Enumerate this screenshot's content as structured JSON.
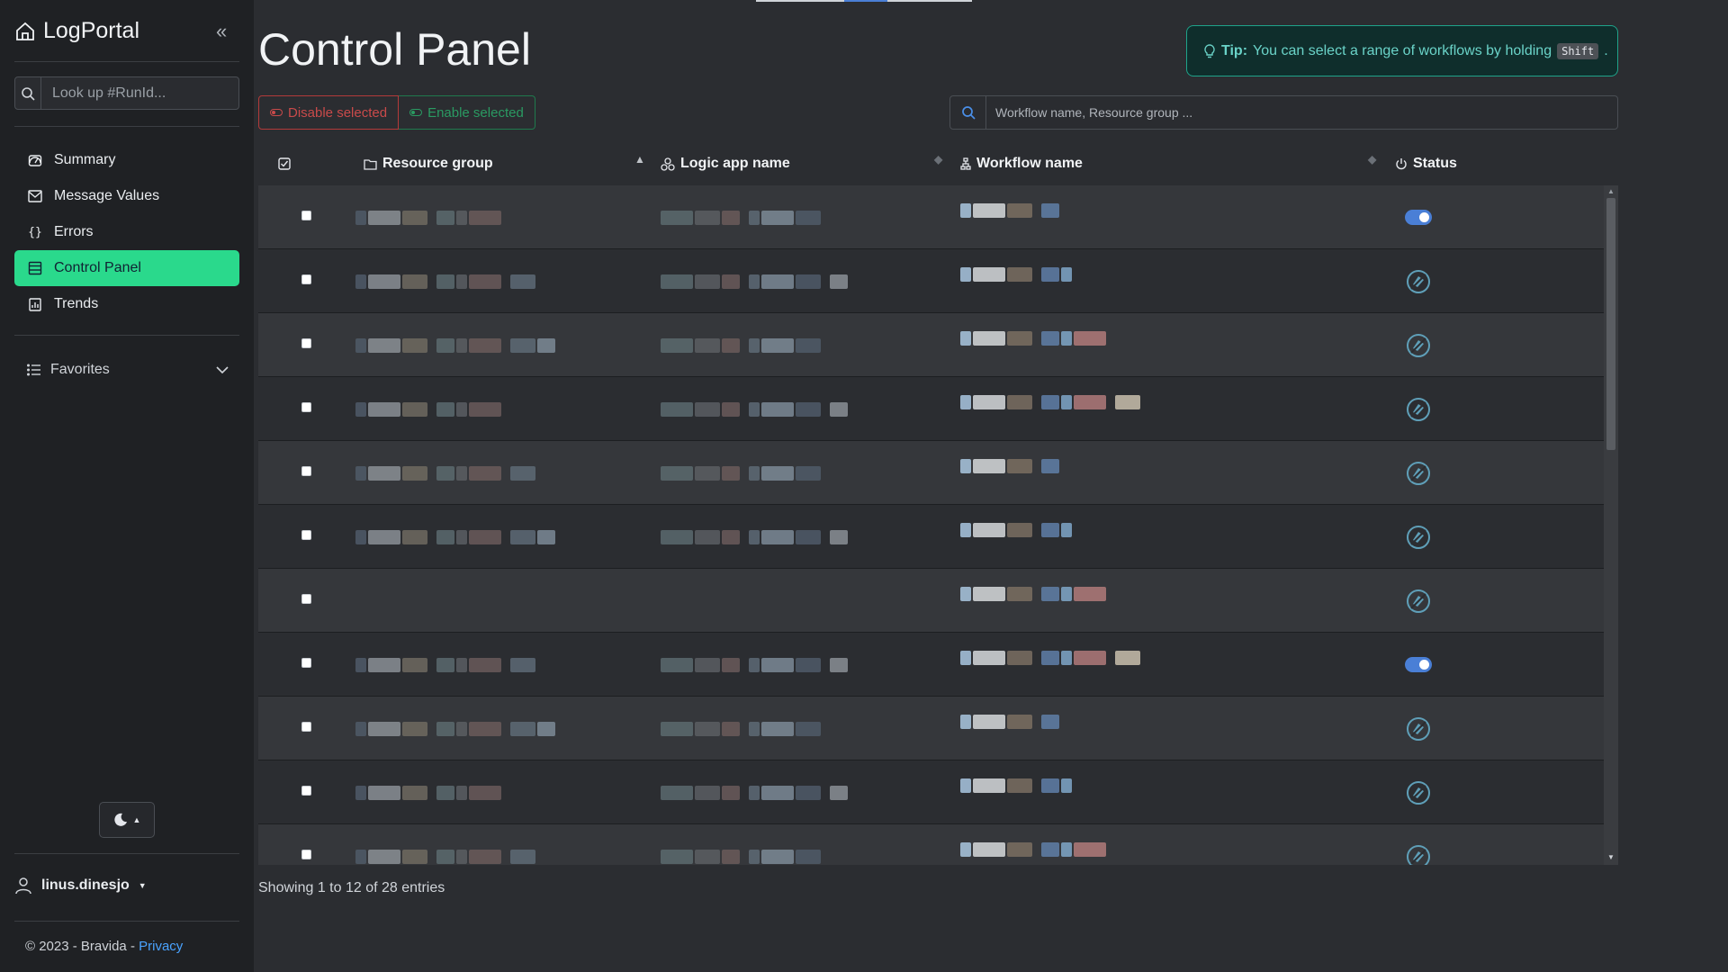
{
  "app": {
    "brand": "LogPortal"
  },
  "sidebar": {
    "lookup_placeholder": "Look up #RunId...",
    "items": [
      {
        "label": "Summary",
        "icon": "gauge-icon"
      },
      {
        "label": "Message Values",
        "icon": "envelope-icon"
      },
      {
        "label": "Errors",
        "icon": "braces-icon"
      },
      {
        "label": "Control Panel",
        "icon": "control-panel-icon",
        "active": true
      },
      {
        "label": "Trends",
        "icon": "chart-icon"
      }
    ],
    "favorites_label": "Favorites",
    "user": "linus.dinesjo",
    "footer": "© 2023 - Bravida - ",
    "privacy_link": "Privacy"
  },
  "main": {
    "title": "Control Panel",
    "tip": {
      "label": "Tip:",
      "text": "You can select a range of workflows by holding",
      "key": "Shift",
      "end": "."
    },
    "buttons": {
      "disable": "Disable selected",
      "enable": "Enable selected"
    },
    "search_placeholder": "Workflow name, Resource group ...",
    "columns": {
      "resource_group": "Resource group",
      "logic_app": "Logic app name",
      "workflow": "Workflow name",
      "status": "Status"
    },
    "rows": [
      {
        "status": "enabled"
      },
      {
        "status": "disabled"
      },
      {
        "status": "disabled"
      },
      {
        "status": "disabled"
      },
      {
        "status": "disabled"
      },
      {
        "status": "disabled"
      },
      {
        "status": "disabled"
      },
      {
        "status": "enabled"
      },
      {
        "status": "disabled"
      },
      {
        "status": "disabled"
      },
      {
        "status": "disabled"
      }
    ],
    "showing": "Showing 1 to 12 of 28 entries"
  },
  "colors": {
    "accent": "#2ad98c",
    "toggle": "#4a7fd6",
    "tip_border": "#1fa38a"
  }
}
